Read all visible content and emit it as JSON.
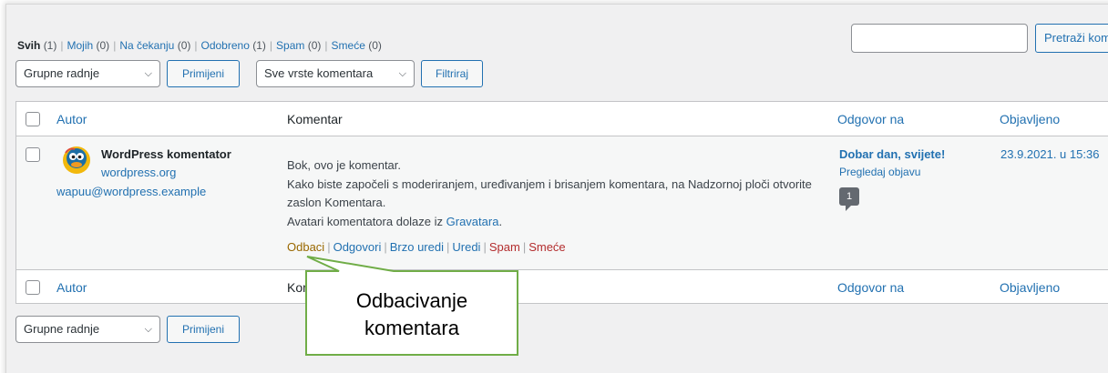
{
  "filters": {
    "all": {
      "label": "Svih",
      "count": "(1)"
    },
    "mine": {
      "label": "Mojih",
      "count": "(0)"
    },
    "pending": {
      "label": "Na čekanju",
      "count": "(0)"
    },
    "approved": {
      "label": "Odobreno",
      "count": "(1)"
    },
    "spam": {
      "label": "Spam",
      "count": "(0)"
    },
    "trash": {
      "label": "Smeće",
      "count": "(0)"
    },
    "separator": "|"
  },
  "search": {
    "value": "",
    "button_label": "Pretraži komentare"
  },
  "top_bar": {
    "bulk_select": "Grupne radnje",
    "apply_label": "Primijeni",
    "type_select": "Sve vrste komentara",
    "filter_label": "Filtriraj"
  },
  "columns": {
    "author": "Autor",
    "comment": "Komentar",
    "response": "Odgovor na",
    "date": "Objavljeno"
  },
  "comment": {
    "author_name": "WordPress komentator",
    "author_url": "wordpress.org",
    "author_email": "wapuu@wordpress.example",
    "line1": "Bok, ovo je komentar.",
    "line2": "Kako biste započeli s moderiranjem, uređivanjem i brisanjem komentara, na Nadzornoj ploči otvorite zaslon Komentara.",
    "line3_prefix": "Avatari komentatora dolaze iz ",
    "line3_link": "Gravatara",
    "line3_suffix": ".",
    "actions": {
      "unapprove": "Odbaci",
      "reply": "Odgovori",
      "quick_edit": "Brzo uredi",
      "edit": "Uredi",
      "spam": "Spam",
      "trash": "Smeće"
    },
    "response_title": "Dobar dan, svijete!",
    "response_view": "Pregledaj objavu",
    "response_count": "1",
    "date": "23.9.2021. u 15:36"
  },
  "bottom_bar": {
    "bulk_select": "Grupne radnje",
    "apply_label": "Primijeni"
  },
  "callout": {
    "line1": "Odbacivanje",
    "line2": "komentara"
  },
  "colors": {
    "link": "#2271b1",
    "unapprove": "#996800",
    "danger": "#b32d2e",
    "callout_border": "#70ad47"
  }
}
